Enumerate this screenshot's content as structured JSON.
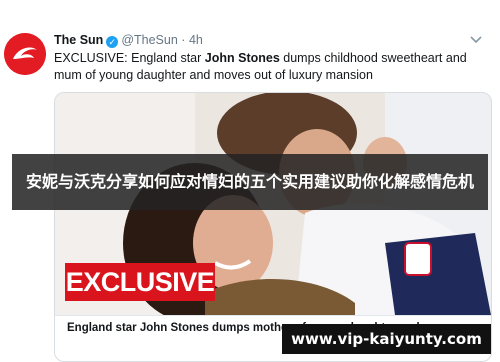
{
  "tweet": {
    "author_name": "The Sun",
    "verified_mark": "✓",
    "handle": "@TheSun",
    "separator": "·",
    "time": "4h",
    "text_prefix": "EXCLUSIVE: England star ",
    "text_bold": "John Stones",
    "text_suffix": " dumps childhood sweetheart and mum of young daughter and moves out of luxury mansion",
    "avatar_logo": "the-sun-logo",
    "menu_icon": "chevron-down-icon"
  },
  "media": {
    "badge": "EXCLUSIVE",
    "caption": "England star John Stones dumps mother of young daughter and mo..."
  },
  "banner": {
    "title": "安妮与沃克分享如何应对情妇的五个实用建议助你化解感情危机"
  },
  "watermark": {
    "text": "www.vip-kaiyunty.com"
  },
  "colors": {
    "sun_red": "#e31b23",
    "badge_red": "#d9141c",
    "verified_blue": "#1da1f2",
    "banner_bg": "#232323"
  }
}
